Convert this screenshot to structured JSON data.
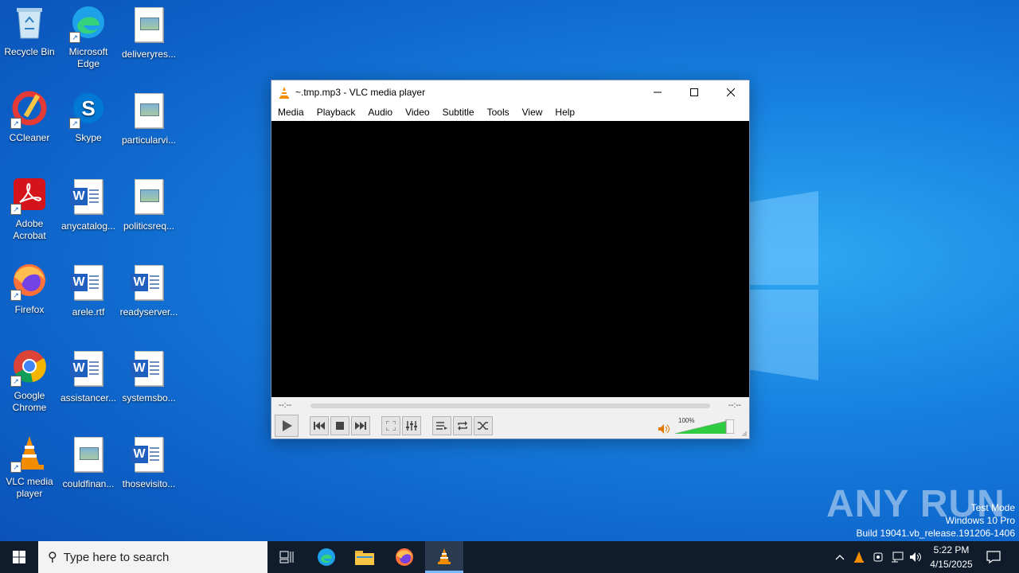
{
  "desktop": {
    "icons": [
      {
        "label": "Recycle Bin",
        "icon": "recycle-bin-icon"
      },
      {
        "label": "Microsoft Edge",
        "icon": "edge-icon"
      },
      {
        "label": "deliveryres...",
        "icon": "image-file-icon"
      },
      {
        "label": "CCleaner",
        "icon": "ccleaner-icon"
      },
      {
        "label": "Skype",
        "icon": "skype-icon"
      },
      {
        "label": "particularvi...",
        "icon": "image-file-icon"
      },
      {
        "label": "Adobe Acrobat",
        "icon": "acrobat-icon"
      },
      {
        "label": "anycatalog...",
        "icon": "word-doc-icon"
      },
      {
        "label": "politicsreq...",
        "icon": "image-file-icon"
      },
      {
        "label": "Firefox",
        "icon": "firefox-icon"
      },
      {
        "label": "arele.rtf",
        "icon": "word-doc-icon"
      },
      {
        "label": "readyserver...",
        "icon": "word-doc-icon"
      },
      {
        "label": "Google Chrome",
        "icon": "chrome-icon"
      },
      {
        "label": "assistancer...",
        "icon": "word-doc-icon"
      },
      {
        "label": "systemsbo...",
        "icon": "word-doc-icon"
      },
      {
        "label": "VLC media player",
        "icon": "vlc-icon"
      },
      {
        "label": "couldfinan...",
        "icon": "image-file-icon"
      },
      {
        "label": "thosevisito...",
        "icon": "word-doc-icon"
      }
    ]
  },
  "vlc": {
    "title": "~.tmp.mp3 - VLC media player",
    "menu": [
      "Media",
      "Playback",
      "Audio",
      "Video",
      "Subtitle",
      "Tools",
      "View",
      "Help"
    ],
    "time_elapsed": "--:--",
    "time_total": "--:--",
    "volume": "100%",
    "volume_level": 1.0
  },
  "watermark": {
    "brand": "ANY RUN",
    "mode": "Test Mode",
    "os": "Windows 10 Pro",
    "build": "Build 19041.vb_release.191206-1406"
  },
  "taskbar": {
    "search_placeholder": "Type here to search",
    "time": "5:22 PM",
    "date": "4/15/2025"
  },
  "colors": {
    "taskbar": "#101c2c",
    "wallpaper": "#1781e0",
    "vlc_orange": "#f28c00",
    "volume_green": "#2ecc40"
  }
}
